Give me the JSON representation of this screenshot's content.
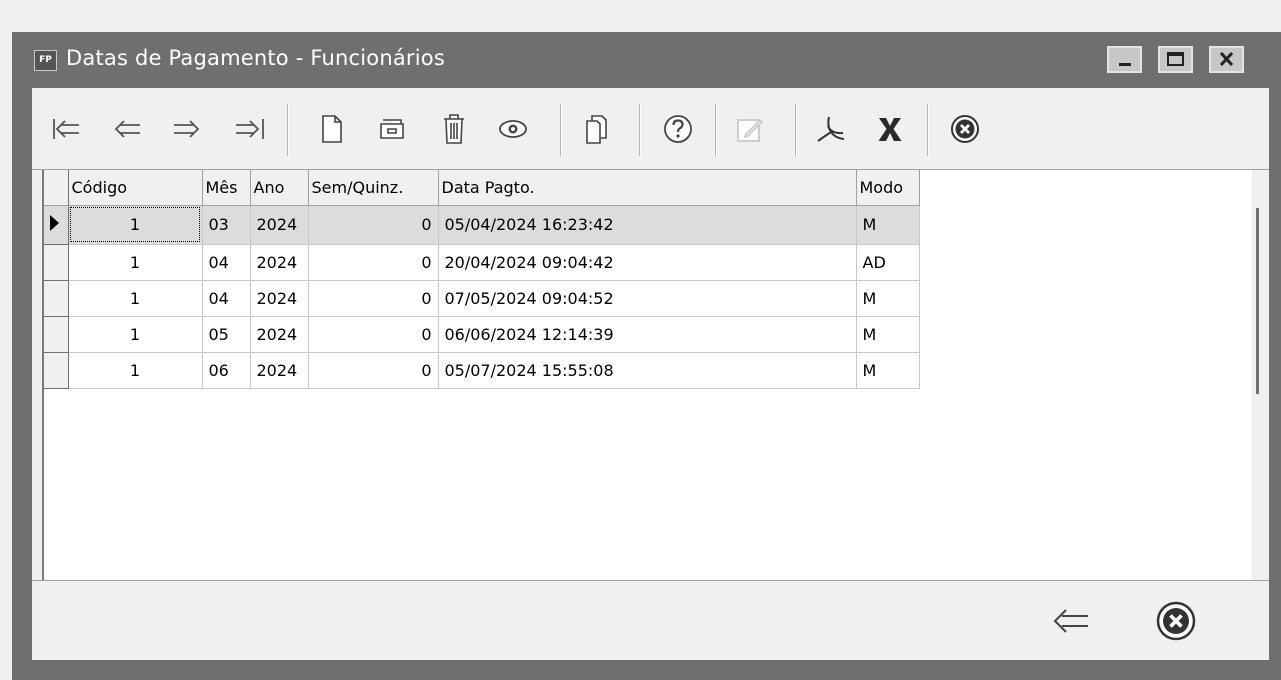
{
  "window": {
    "app_icon_text": "FP",
    "title": "Datas de Pagamento - Funcionários",
    "buttons": [
      "minimize",
      "maximize",
      "close"
    ]
  },
  "toolbar": {
    "icons": [
      "first-record-icon",
      "previous-record-icon",
      "next-record-icon",
      "last-record-icon",
      "new-icon",
      "archive-icon",
      "delete-icon",
      "view-icon",
      "copy-icon",
      "help-icon",
      "edit-icon",
      "pdf-icon",
      "excel-icon",
      "close-circle-icon"
    ]
  },
  "grid": {
    "columns": [
      "Código",
      "Mês",
      "Ano",
      "Sem/Quinz.",
      "Data Pagto.",
      "Modo"
    ],
    "rows": [
      {
        "codigo": "1",
        "mes": "03",
        "ano": "2024",
        "sem": "0",
        "data": "05/04/2024 16:23:42",
        "modo": "M"
      },
      {
        "codigo": "1",
        "mes": "04",
        "ano": "2024",
        "sem": "0",
        "data": "20/04/2024 09:04:42",
        "modo": "AD"
      },
      {
        "codigo": "1",
        "mes": "04",
        "ano": "2024",
        "sem": "0",
        "data": "07/05/2024 09:04:52",
        "modo": "M"
      },
      {
        "codigo": "1",
        "mes": "05",
        "ano": "2024",
        "sem": "0",
        "data": "06/06/2024 12:14:39",
        "modo": "M"
      },
      {
        "codigo": "1",
        "mes": "06",
        "ano": "2024",
        "sem": "0",
        "data": "05/07/2024 15:55:08",
        "modo": "M"
      }
    ]
  },
  "bottom": {
    "icons": [
      "back-arrow-icon",
      "close-circle-icon"
    ]
  }
}
